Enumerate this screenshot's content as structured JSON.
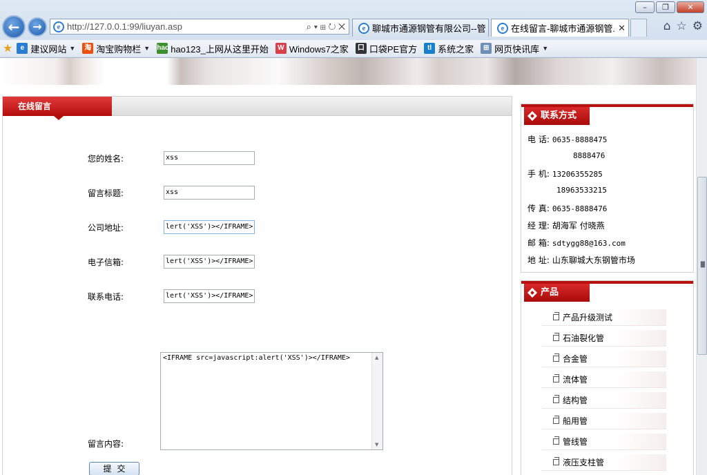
{
  "window": {
    "minimize": "–",
    "restore": "❐",
    "close": "✕"
  },
  "address": {
    "url": "http://127.0.0.1:99/liuyan.asp",
    "tools": "⌕ ▾ ⊞ ↻ ✕"
  },
  "tabs": [
    {
      "label": "聊城市通源钢管有限公司--管...",
      "close": ""
    },
    {
      "label": "在线留言-聊城市通源钢管...",
      "close": "✕"
    }
  ],
  "favorites": [
    {
      "label": "建议网站",
      "caret": true,
      "icon_color": "#2a7dd1",
      "icon": "e"
    },
    {
      "label": "淘宝购物栏",
      "caret": true,
      "icon_color": "#e8500c",
      "icon": "淘"
    },
    {
      "label": "hao123_上网从这里开始",
      "caret": false,
      "icon_color": "#3d8f2d",
      "icon": "hao"
    },
    {
      "label": "Windows7之家",
      "caret": false,
      "icon_color": "#d8404a",
      "icon": "W"
    },
    {
      "label": "口袋PE官方",
      "caret": false,
      "icon_color": "#333333",
      "icon": "口"
    },
    {
      "label": "系统之家",
      "caret": false,
      "icon_color": "#1a7fc9",
      "icon": "tl"
    },
    {
      "label": "网页快讯库",
      "caret": true,
      "icon_color": "#6f8fb8",
      "icon": "⊞"
    }
  ],
  "main": {
    "title": "在线留言",
    "fields": [
      {
        "label": "您的姓名:",
        "value": "xss"
      },
      {
        "label": "留言标题:",
        "value": "xss"
      },
      {
        "label": "公司地址:",
        "value": "lert('XSS')></IFRAME>"
      },
      {
        "label": "电子信箱:",
        "value": "lert('XSS')></IFRAME>"
      },
      {
        "label": "联系电话:",
        "value": "lert('XSS')></IFRAME>"
      }
    ],
    "message_label": "留言内容:",
    "message_value": "<IFRAME src=javascript:alert('XSS')></IFRAME>",
    "submit": "提交"
  },
  "contact": {
    "title": "联系方式",
    "lines": [
      {
        "label": "电 话:",
        "value": "0635-8888475"
      },
      {
        "label": "",
        "value": "8888476"
      },
      {
        "label": "手 机:",
        "value": "13206355285"
      },
      {
        "label": "",
        "value": "18963533215"
      },
      {
        "label": "传 真:",
        "value": "0635-8888476"
      },
      {
        "label": "经 理:",
        "value": "胡海军 付晓燕"
      },
      {
        "label": "邮 箱:",
        "value": "sdtygg88@163.com"
      },
      {
        "label": "地 址:",
        "value": "山东聊城大东钢管市场"
      }
    ]
  },
  "products": {
    "title": "产品",
    "items": [
      "产品升级测试",
      "石油裂化管",
      "合金管",
      "流体管",
      "结构管",
      "船用管",
      "管线管",
      "液压支柱管"
    ]
  }
}
